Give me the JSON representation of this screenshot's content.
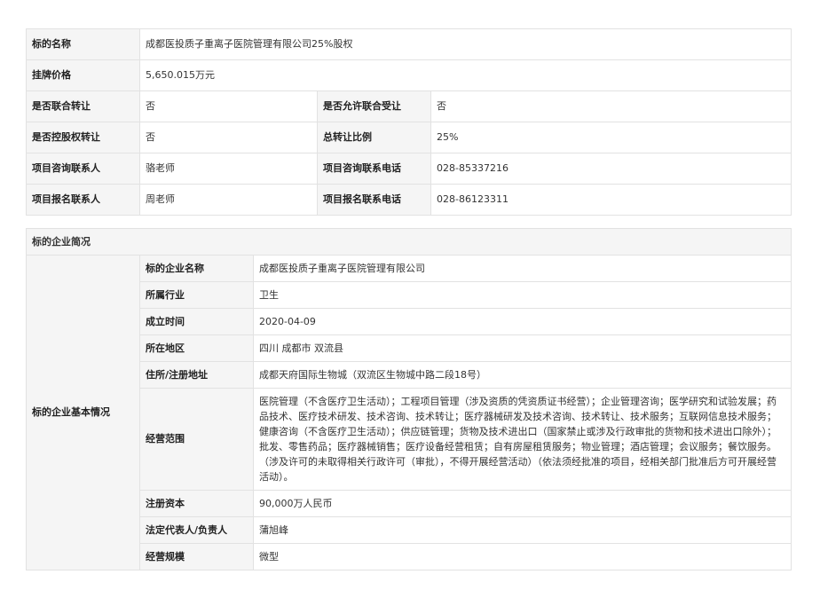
{
  "transfer_info": {
    "target_name_label": "标的名称",
    "target_name_value": "成都医投质子重离子医院管理有限公司25%股权",
    "listing_price_label": "挂牌价格",
    "listing_price_value": "5,650.015万元",
    "joint_transfer_label": "是否联合转让",
    "joint_transfer_value": "否",
    "allow_joint_transferee_label": "是否允许联合受让",
    "allow_joint_transferee_value": "否",
    "control_transfer_label": "是否控股权转让",
    "control_transfer_value": "否",
    "total_ratio_label": "总转让比例",
    "total_ratio_value": "25%",
    "consult_contact_label": "项目咨询联系人",
    "consult_contact_value": "骆老师",
    "consult_phone_label": "项目咨询联系电话",
    "consult_phone_value": "028-85337216",
    "signup_contact_label": "项目报名联系人",
    "signup_contact_value": "周老师",
    "signup_phone_label": "项目报名联系电话",
    "signup_phone_value": "028-86123311"
  },
  "company": {
    "section_title": "标的企业简况",
    "group_label": "标的企业基本情况",
    "rows": [
      {
        "label": "标的企业名称",
        "value": "成都医投质子重离子医院管理有限公司"
      },
      {
        "label": "所属行业",
        "value": "卫生"
      },
      {
        "label": "成立时间",
        "value": "2020-04-09"
      },
      {
        "label": "所在地区",
        "value": "四川 成都市 双流县"
      },
      {
        "label": "住所/注册地址",
        "value": "成都天府国际生物城（双流区生物城中路二段18号）"
      },
      {
        "label": "经营范围",
        "value": "医院管理（不含医疗卫生活动）；工程项目管理（涉及资质的凭资质证书经营）；企业管理咨询；医学研究和试验发展；药品技术、医疗技术研发、技术咨询、技术转让；医疗器械研发及技术咨询、技术转让、技术服务；互联网信息技术服务；健康咨询（不含医疗卫生活动）；供应链管理；货物及技术进出口（国家禁止或涉及行政审批的货物和技术进出口除外）；批发、零售药品；医疗器械销售；医疗设备经营租赁；自有房屋租赁服务；物业管理；酒店管理；会议服务；餐饮服务。（涉及许可的未取得相关行政许可（审批），不得开展经营活动）（依法须经批准的项目，经相关部门批准后方可开展经营活动）。"
      },
      {
        "label": "注册资本",
        "value": "90,000万人民币"
      },
      {
        "label": "法定代表人/负责人",
        "value": "蒲旭峰"
      },
      {
        "label": "经营规模",
        "value": "微型"
      }
    ]
  }
}
